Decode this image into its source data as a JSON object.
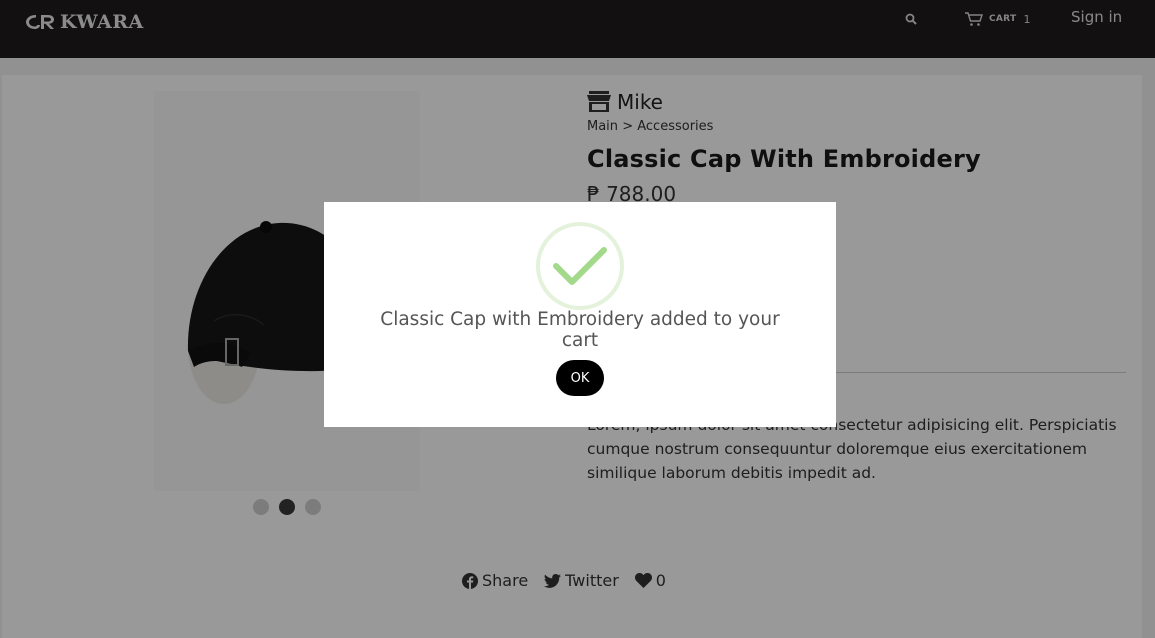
{
  "header": {
    "brand": "KWARA",
    "cart_label": "CART",
    "cart_count": "1",
    "signin_label": "Sign in"
  },
  "product": {
    "store_name": "Mike",
    "breadcrumb": [
      "Main",
      ">",
      "Accessories"
    ],
    "title": "Classic Cap With Embroidery",
    "price": "₱ 788.00",
    "description": "Lorem, ipsum dolor sit amet consectetur adipisicing elit. Perspiciatis cumque nostrum consequuntur doloremque eius exercitationem similique laborum debitis impedit ad.",
    "image_dots": 3,
    "active_dot": 2
  },
  "social": {
    "share_label": "Share",
    "twitter_label": "Twitter",
    "like_count": "0"
  },
  "modal": {
    "message": "Classic Cap with Embroidery added to your cart",
    "ok_label": "OK"
  },
  "icons": {
    "logo": "kwara-logo-icon",
    "search": "search-icon",
    "cart": "cart-icon",
    "store": "store-icon",
    "share": "facebook-icon",
    "twitter": "twitter-icon",
    "like": "heart-icon",
    "success": "checkmark-icon",
    "next": "chevron-right-icon"
  },
  "colors": {
    "header_bg": "#1f1b1b",
    "check_green": "#a3d98a",
    "ok_button_bg": "#000000"
  }
}
